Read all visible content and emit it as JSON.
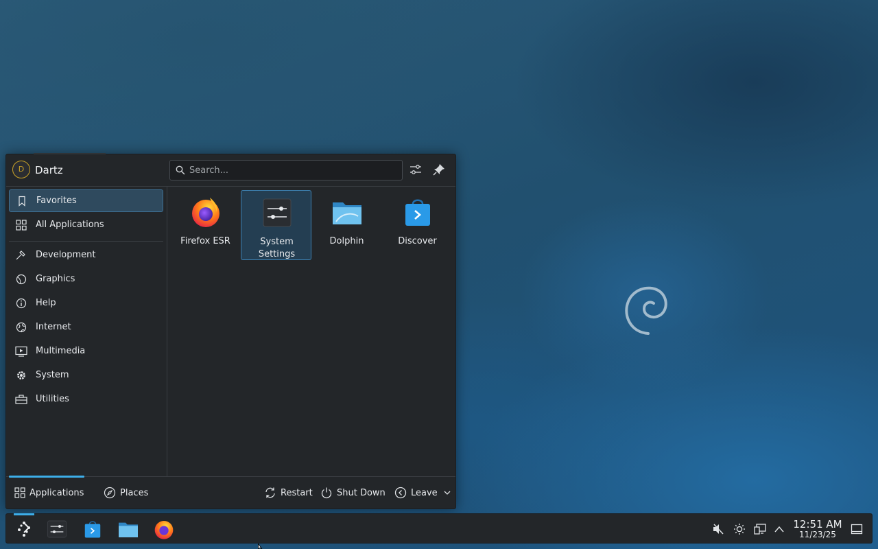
{
  "launcher": {
    "user": {
      "initial": "D",
      "name": "Dartz"
    },
    "search": {
      "placeholder": "Search..."
    },
    "categories": [
      {
        "label": "Favorites",
        "icon": "bookmark-icon",
        "active": true
      },
      {
        "label": "All Applications",
        "icon": "grid-icon"
      },
      {
        "label": "Development",
        "icon": "hammer-icon"
      },
      {
        "label": "Graphics",
        "icon": "graphics-icon"
      },
      {
        "label": "Help",
        "icon": "info-icon"
      },
      {
        "label": "Internet",
        "icon": "globe-icon"
      },
      {
        "label": "Multimedia",
        "icon": "multimedia-icon"
      },
      {
        "label": "System",
        "icon": "gear-icon"
      },
      {
        "label": "Utilities",
        "icon": "toolbox-icon"
      }
    ],
    "favorites": [
      {
        "line1": "Firefox ESR",
        "line2": "",
        "icon": "firefox-icon"
      },
      {
        "line1": "System",
        "line2": "Settings",
        "icon": "system-settings-icon",
        "selected": true
      },
      {
        "line1": "Dolphin",
        "line2": "",
        "icon": "dolphin-icon"
      },
      {
        "line1": "Discover",
        "line2": "",
        "icon": "discover-icon"
      }
    ],
    "footer": {
      "tabs": [
        "Applications",
        "Places"
      ],
      "actions": [
        "Restart",
        "Shut Down",
        "Leave"
      ]
    }
  },
  "taskbar": {
    "apps": [
      "launcher-icon",
      "system-settings-icon",
      "discover-icon",
      "dolphin-icon",
      "firefox-icon"
    ],
    "clock": {
      "time": "12:51 AM",
      "date": "11/23/25"
    }
  },
  "colors": {
    "accent": "#3daee9",
    "panel": "#232629",
    "highlight": "#2f4a5e"
  }
}
